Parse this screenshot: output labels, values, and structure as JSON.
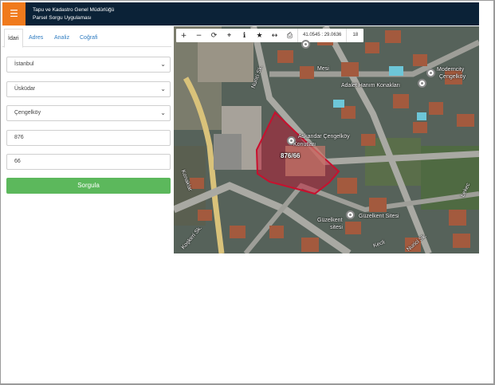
{
  "header": {
    "title_line1": "Tapu ve Kadastro Genel Müdürlüğü",
    "title_line2": "Parsel Sorgu Uygulaması",
    "menu_icon": "hamburger-icon",
    "accent_color": "#f07a1c",
    "bar_color": "#0b2237"
  },
  "tabs": [
    {
      "label": "İdari",
      "active": true
    },
    {
      "label": "Adres",
      "active": false
    },
    {
      "label": "Analiz",
      "active": false
    },
    {
      "label": "Coğrafi",
      "active": false
    }
  ],
  "form": {
    "province": "İstanbul",
    "district": "Üsküdar",
    "neighborhood": "Çengelköy",
    "block": "876",
    "parcel": "66",
    "submit_label": "Sorgula",
    "submit_color": "#5cb85c"
  },
  "map": {
    "toolbar_icons": [
      "zoom-in-icon",
      "zoom-out-icon",
      "refresh-icon",
      "locate-icon",
      "info-icon",
      "star-icon",
      "measure-icon",
      "print-icon"
    ],
    "coordinates": "41.0545 : 29.0636",
    "zoom_level": "18",
    "parcel_label": "876/66",
    "labels": {
      "poi_1": "Askandar Çengelköy",
      "poi_1b": "Konutları",
      "poi_2": "Adalet Hanım Konakları",
      "poi_3": "Moderncity",
      "poi_3b": "Çengelköy",
      "poi_4": "Güzelkent Sitesi",
      "poi_4b": "Güzelkent",
      "poi_4c": "sitesi",
      "poi_5": "Mesi",
      "street_1": "Nurici Sk.",
      "street_2": "Koşkeri Sk.",
      "street_3": "Nurici Sk.",
      "street_4": "Konaklar",
      "street_5": "Lekec",
      "street_6": "Kecli"
    },
    "parcel_color": "#c8102e"
  }
}
